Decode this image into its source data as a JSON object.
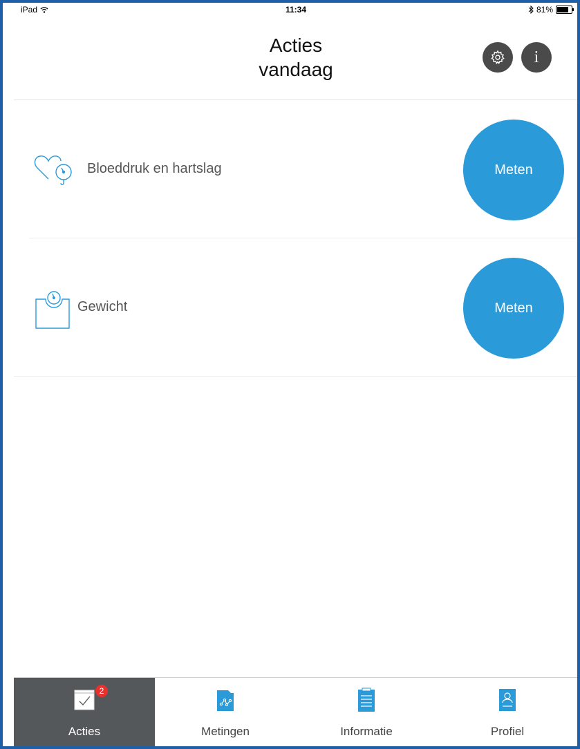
{
  "status_bar": {
    "device": "iPad",
    "time": "11:34",
    "battery": "81%"
  },
  "header": {
    "title_line1": "Acties",
    "title_line2": "vandaag",
    "settings_icon": "gear-icon",
    "info_icon": "info-icon",
    "info_glyph": "i"
  },
  "actions": [
    {
      "label": "Bloeddruk en hartslag",
      "icon": "heart-gauge-icon",
      "button": "Meten"
    },
    {
      "label": "Gewicht",
      "icon": "scale-icon",
      "button": "Meten"
    }
  ],
  "tabs": [
    {
      "label": "Acties",
      "icon": "checklist-icon",
      "badge": "2",
      "active": true
    },
    {
      "label": "Metingen",
      "icon": "chart-folder-icon"
    },
    {
      "label": "Informatie",
      "icon": "document-icon"
    },
    {
      "label": "Profiel",
      "icon": "profile-icon"
    }
  ],
  "colors": {
    "accent": "#2a9ad9",
    "active_tab": "#55585b",
    "badge": "#e6312f",
    "header_button": "#4a4a4a"
  }
}
